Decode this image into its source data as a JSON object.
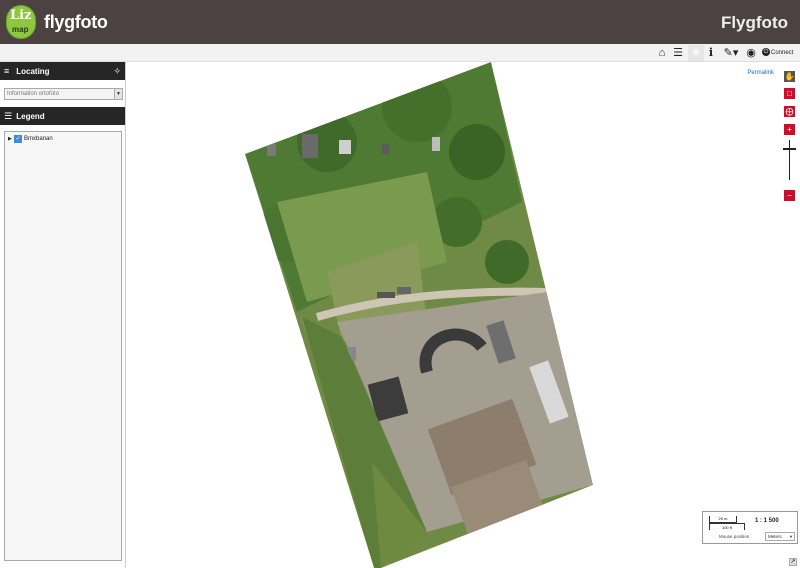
{
  "header": {
    "logo_text_top": "Liz",
    "logo_text_bottom": "map",
    "app_title": "flygfoto",
    "project_title": "Flygfoto"
  },
  "toolbar": {
    "connect_label": "Connect"
  },
  "sidebar": {
    "locating": {
      "title": "Locating",
      "select_value": "Information ortofoto"
    },
    "legend": {
      "title": "Legend",
      "items": [
        {
          "label": "Bmxbanan",
          "checked": true
        }
      ]
    }
  },
  "map": {
    "permalink_label": "Permalink",
    "scale": {
      "bar_top_label": "20 m",
      "bar_bottom_label": "100 ft",
      "ratio": "1 : 1 500",
      "mouse_position_label": "Mouse position",
      "units_value": "Meters"
    }
  },
  "colors": {
    "header_bg": "#4c4242",
    "panel_header_bg": "#262626",
    "zoom_control": "#c8102e",
    "logo_green": "#8dc63f",
    "link_blue": "#1f6fbf"
  }
}
